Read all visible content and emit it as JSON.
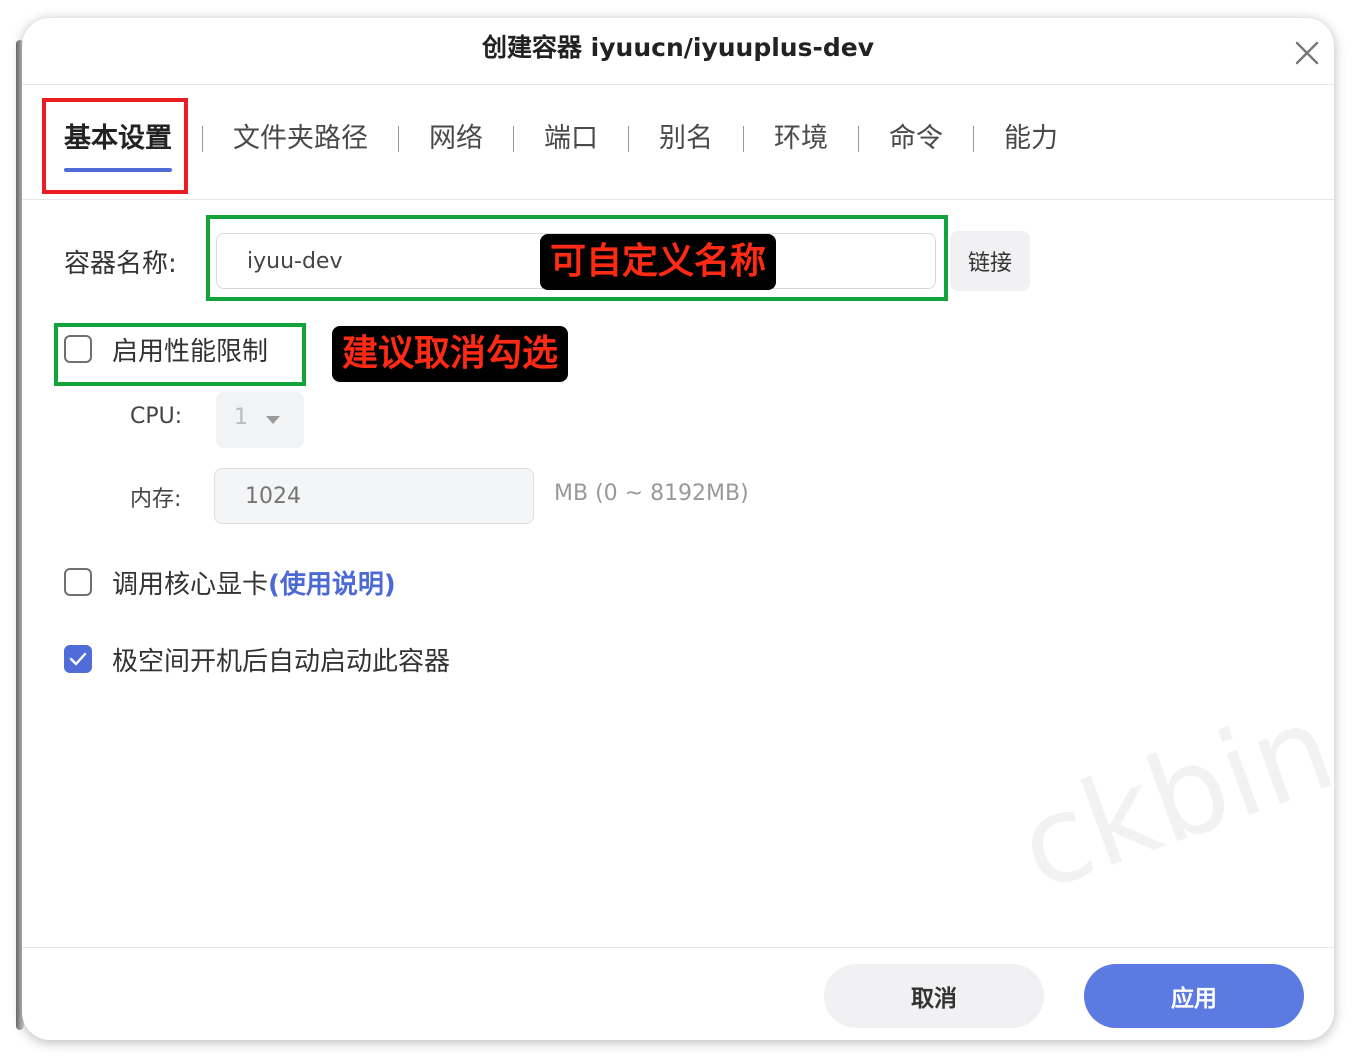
{
  "dialog": {
    "title": "创建容器 iyuucn/iyuuplus-dev"
  },
  "tabs": [
    {
      "label": "基本设置",
      "active": true
    },
    {
      "label": "文件夹路径"
    },
    {
      "label": "网络"
    },
    {
      "label": "端口"
    },
    {
      "label": "别名"
    },
    {
      "label": "环境"
    },
    {
      "label": "命令"
    },
    {
      "label": "能力"
    }
  ],
  "form": {
    "container_name_label": "容器名称:",
    "container_name_value": "iyuu-dev",
    "link_button": "链接",
    "perf_limit_label": "启用性能限制",
    "perf_limit_checked": false,
    "cpu_label": "CPU:",
    "cpu_value": "1",
    "memory_label": "内存:",
    "memory_placeholder": "1024",
    "memory_range": "MB (0 ~ 8192MB)",
    "gpu_label": "调用核心显卡",
    "gpu_help_link": "(使用说明)",
    "gpu_checked": false,
    "autostart_label": "极空间开机后自动启动此容器",
    "autostart_checked": true
  },
  "footer": {
    "cancel": "取消",
    "apply": "应用"
  },
  "annotations": {
    "name_callout": "可自定义名称",
    "perf_callout": "建议取消勾选"
  },
  "watermark": "ckbin",
  "colors": {
    "accent": "#4f6cd9",
    "apply_button": "#5b7be3",
    "highlight_red": "#ea1d24",
    "highlight_green": "#12a33c",
    "callout_text": "#ff2a14"
  }
}
